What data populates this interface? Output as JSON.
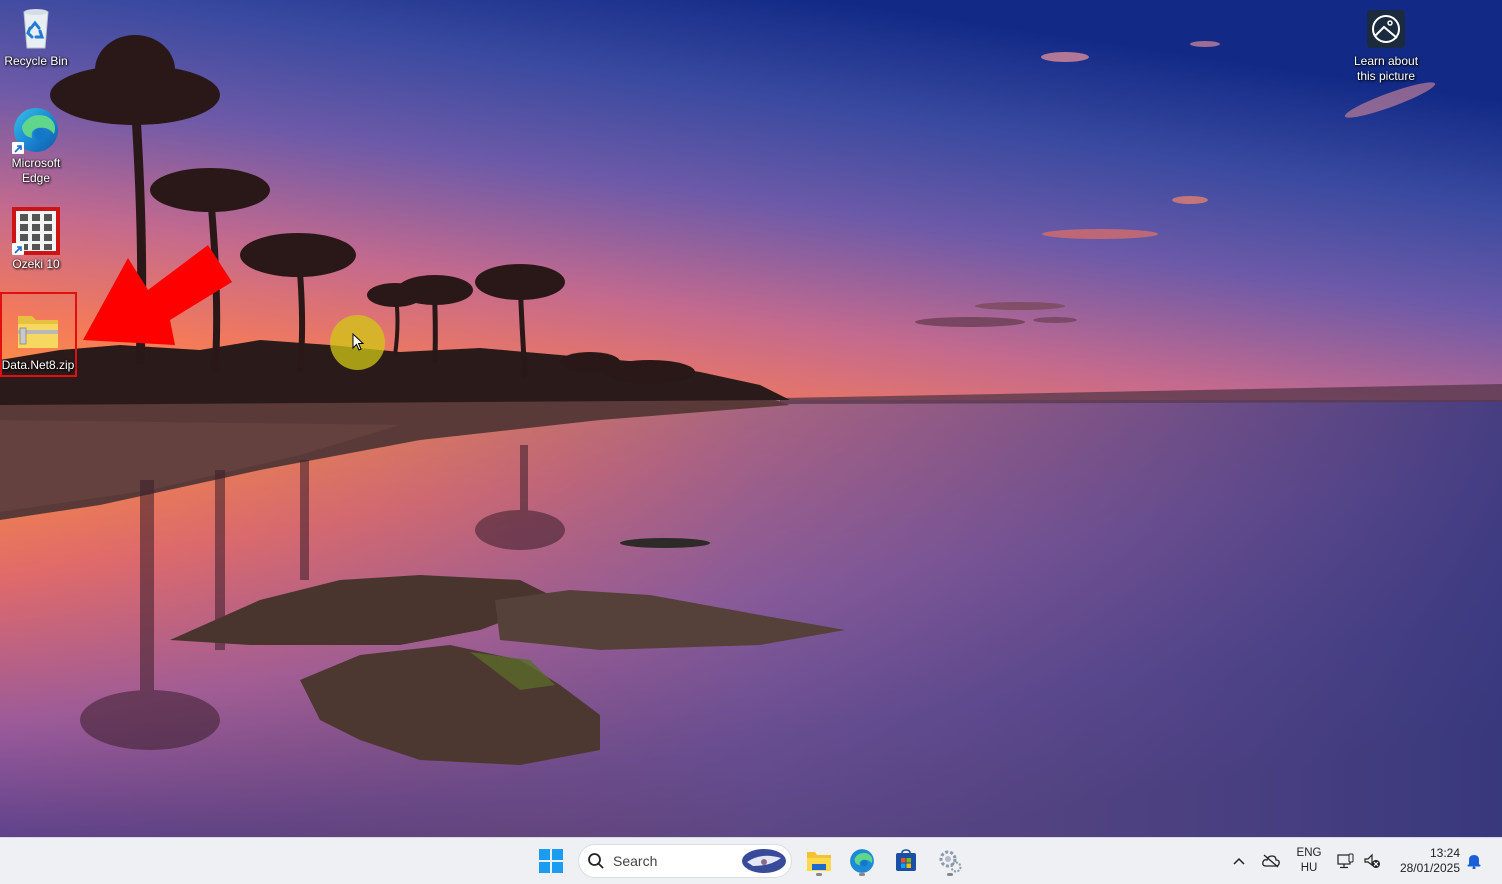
{
  "desktop": {
    "icons": [
      {
        "label": "Recycle Bin",
        "icon": "recycle-bin-icon"
      },
      {
        "label": "Microsoft Edge",
        "icon": "edge-icon"
      },
      {
        "label": "Ozeki 10",
        "icon": "ozeki-keypad-icon"
      },
      {
        "label": "Data.Net8.zip",
        "icon": "zip-folder-icon"
      }
    ],
    "spotlight": {
      "label_line1": "Learn about",
      "label_line2": "this picture",
      "icon": "picture-info-icon"
    },
    "annotation": {
      "arrow_color": "#ff0000",
      "highlight_color": "#e01010",
      "target": "Data.Net8.zip"
    },
    "cursor_highlight_color": "#d2c814"
  },
  "taskbar": {
    "start_icon": "windows-start-icon",
    "search": {
      "placeholder": "Search"
    },
    "pinned": [
      {
        "name": "File Explorer",
        "icon": "file-explorer-icon",
        "running": true
      },
      {
        "name": "Microsoft Edge",
        "icon": "edge-icon",
        "running": true
      },
      {
        "name": "Microsoft Store",
        "icon": "store-icon",
        "running": false
      },
      {
        "name": "Settings",
        "icon": "settings-gear-icon",
        "running": true
      }
    ],
    "tray": {
      "language_line1": "ENG",
      "language_line2": "HU",
      "time": "13:24",
      "date": "28/01/2025"
    }
  }
}
